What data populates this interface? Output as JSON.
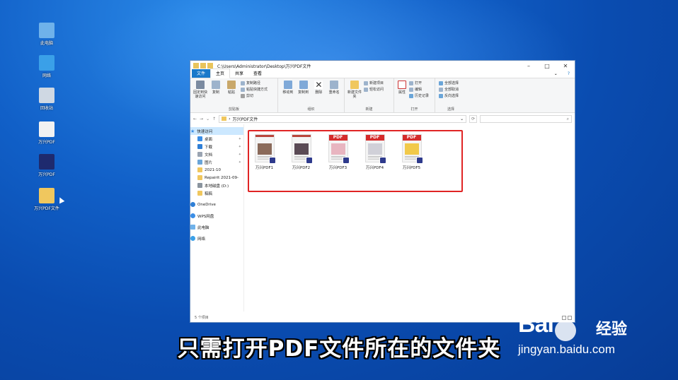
{
  "desktop": {
    "icons": [
      {
        "label": "此电脑",
        "icon": "this-pc-icon",
        "color": "#6fb2ea"
      },
      {
        "label": "网络",
        "icon": "network-icon",
        "color": "#3aa0e8"
      },
      {
        "label": "回收站",
        "icon": "recycle-bin-icon",
        "color": "#cfd8e3"
      },
      {
        "label": "万兴PDF",
        "icon": "pdf-file-icon",
        "color": "#f2f2f2"
      },
      {
        "label": "万兴PDF",
        "icon": "wondershare-pdf-app-icon",
        "color": "#1e2a6e"
      },
      {
        "label": "万兴PDF文件",
        "icon": "folder-icon",
        "color": "#f0c75e"
      }
    ]
  },
  "explorer": {
    "title_path": "C:\\Users\\Administrator\\Desktop\\万兴PDF文件",
    "tabs": [
      "文件",
      "主页",
      "共享",
      "查看"
    ],
    "selected_tab": "主页",
    "ribbon": {
      "clipboard": {
        "label": "剪贴板",
        "pin": "固定到快速访问",
        "copy": "复制",
        "paste": "粘贴",
        "copy_path": "复制路径",
        "paste_shortcut": "粘贴快捷方式",
        "cut": "剪切"
      },
      "organize": {
        "label": "组织",
        "move_to": "移动到",
        "copy_to": "复制到",
        "delete": "删除",
        "rename": "重命名"
      },
      "new": {
        "label": "新建",
        "new_folder": "新建文件夹",
        "new_item": "新建项目",
        "easy_access": "轻松访问"
      },
      "open": {
        "label": "打开",
        "properties": "属性",
        "open": "打开",
        "edit": "编辑",
        "history": "历史记录"
      },
      "select": {
        "label": "选择",
        "select_all": "全部选择",
        "select_none": "全部取消",
        "invert": "反向选择"
      }
    },
    "address": {
      "crumb": "万兴PDF文件",
      "separator": "›"
    },
    "search_placeholder": "",
    "nav": {
      "quick_access": "快速访问",
      "items": [
        {
          "label": "桌面",
          "icon": "desktop-icon",
          "color": "#3a8ee6"
        },
        {
          "label": "下载",
          "icon": "download-icon",
          "color": "#2f7fd6"
        },
        {
          "label": "文档",
          "icon": "document-icon",
          "color": "#9aa4b2"
        },
        {
          "label": "图片",
          "icon": "pictures-icon",
          "color": "#6aa5d8"
        },
        {
          "label": "2021-10",
          "icon": "folder-icon",
          "color": "#f0c75e"
        },
        {
          "label": "Repairit 2021-09-",
          "icon": "folder-icon",
          "color": "#f0c75e"
        },
        {
          "label": "本地磁盘 (D:)",
          "icon": "drive-icon",
          "color": "#8a949e"
        },
        {
          "label": "稿稿",
          "icon": "folder-icon",
          "color": "#f0c75e"
        }
      ],
      "onedrive": "OneDrive",
      "wps": "WPS网盘",
      "this_pc": "此电脑",
      "network": "网络"
    },
    "files": [
      {
        "name": "万兴PDF1",
        "header": "",
        "img": "#8a6a5a"
      },
      {
        "name": "万兴PDF2",
        "header": "",
        "img": "#5a4a55"
      },
      {
        "name": "万兴PDF3",
        "header": "PDF",
        "img": "#e8b5c0"
      },
      {
        "name": "万兴PDF4",
        "header": "PDF",
        "img": "#d0d0d8"
      },
      {
        "name": "万兴PDF5",
        "header": "PDF",
        "img": "#f1c94a"
      }
    ],
    "status": "5 个项目"
  },
  "subtitle": "只需打开PDF文件所在的文件夹",
  "watermark": {
    "logo_left": "Bai",
    "logo_right": "经验",
    "url": "jingyan.baidu.com"
  }
}
